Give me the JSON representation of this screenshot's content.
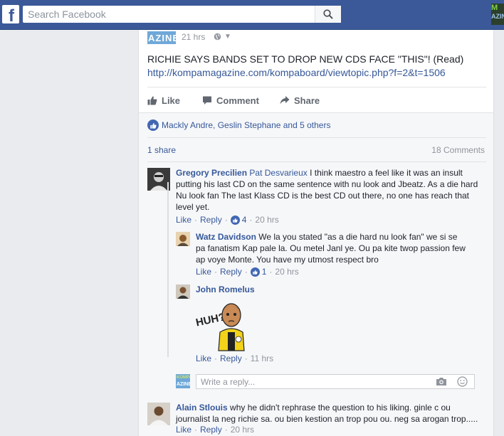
{
  "topbar": {
    "logo": "f",
    "search_placeholder": "Search Facebook",
    "corner_thumb_line1": "M",
    "corner_thumb_line2": "AZINE"
  },
  "post": {
    "page_thumb_text": "AZINE",
    "time": "21 hrs",
    "text": "RICHIE SAYS BANDS SET TO DROP NEW CDS FACE \"THIS\"! (Read)",
    "link": "http://kompamagazine.com/kompaboard/viewtopic.php?f=2&t=1506",
    "actions": {
      "like": "Like",
      "comment": "Comment",
      "share": "Share"
    }
  },
  "ufi": {
    "likers": "Mackly Andre, Geslin Stephane and 5 others",
    "shares": "1 share",
    "comment_count": "18 Comments",
    "comments": [
      {
        "author": "Gregory Precilien",
        "tagged": "Pat Desvarieux",
        "text": " I think maestro a feel like it was an insult putting his last CD on the same sentence with nu look and Jbeatz. As a die hard Nu look fan The last Klass CD is the best CD out there, no one has reach that level yet.",
        "like_label": "Like",
        "reply_label": "Reply",
        "like_count": "4",
        "time": "20 hrs"
      },
      {
        "author": "Alain Stlouis",
        "text": " why he didn't rephrase the question to his liking. ginle c ou journalist la neg richie sa. ou bien kestion an trop pou ou. neg sa arogan trop.....",
        "like_label": "Like",
        "reply_label": "Reply",
        "time": "20 hrs"
      }
    ],
    "replies": [
      {
        "author": "Watz Davidson",
        "text": " We la you stated \"as a die hard nu look fan\" we si se pa fanatism Kap pale la. Ou metel Janl ye. Ou pa kite twop passion few ap voye Monte. You have my utmost respect bro",
        "like_label": "Like",
        "reply_label": "Reply",
        "like_count": "1",
        "time": "20 hrs"
      },
      {
        "author": "John Romelus",
        "sticker_text": "HUH?",
        "like_label": "Like",
        "reply_label": "Reply",
        "time": "11 hrs"
      }
    ],
    "reply_box": {
      "avatar_line1": "KOMPA",
      "avatar_line2": "AZINE",
      "placeholder": "Write a reply..."
    }
  },
  "colors": {
    "brand": "#3b5998",
    "link": "#365899",
    "muted": "#90949c",
    "like_blue": "#4267b2"
  }
}
